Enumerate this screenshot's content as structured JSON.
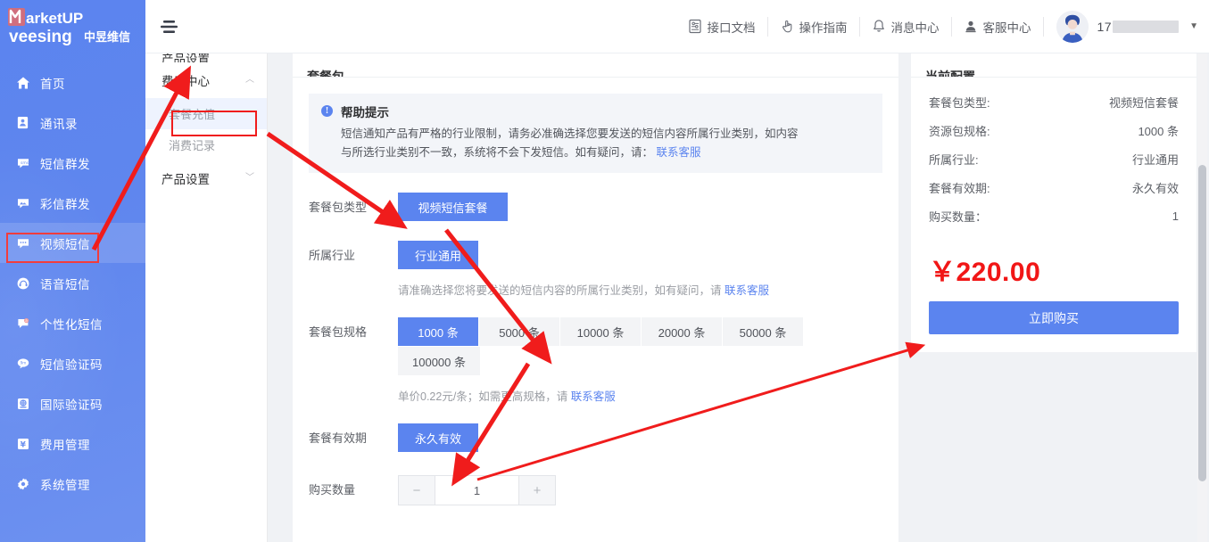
{
  "brand": {
    "line1": "arketUP",
    "line2": "veesing",
    "line2_cn": "中昱维信"
  },
  "sidebar": {
    "items": [
      {
        "label": "首页",
        "icon": "home-icon"
      },
      {
        "label": "通讯录",
        "icon": "contacts-icon"
      },
      {
        "label": "短信群发",
        "icon": "sms-bulk-icon"
      },
      {
        "label": "彩信群发",
        "icon": "mms-bulk-icon"
      },
      {
        "label": "视频短信",
        "icon": "video-sms-icon"
      },
      {
        "label": "语音短信",
        "icon": "voice-sms-icon"
      },
      {
        "label": "个性化短信",
        "icon": "personalized-sms-icon"
      },
      {
        "label": "短信验证码",
        "icon": "sms-code-icon"
      },
      {
        "label": "国际验证码",
        "icon": "intl-code-icon"
      },
      {
        "label": "费用管理",
        "icon": "fee-management-icon"
      },
      {
        "label": "系统管理",
        "icon": "system-settings-icon"
      }
    ],
    "active_index": 4
  },
  "submenu": {
    "cut_label": "产品设置",
    "group_label": "费用中心",
    "group_caret": "︿",
    "items": [
      {
        "label": "套餐充值",
        "current": true
      },
      {
        "label": "消费记录",
        "current": false
      }
    ],
    "group2_label": "产品设置",
    "group2_caret": "﹀"
  },
  "header": {
    "hamburger": "collapse-menu-icon",
    "actions": [
      {
        "label": "接口文档",
        "icon": "api-doc-icon"
      },
      {
        "label": "操作指南",
        "icon": "guide-hand-icon"
      },
      {
        "label": "消息中心",
        "icon": "bell-icon"
      },
      {
        "label": "客服中心",
        "icon": "service-person-icon"
      }
    ],
    "user": {
      "name_prefix": "17",
      "masked": true,
      "caret": "▼"
    }
  },
  "main": {
    "left_card_title": "套餐包",
    "tip": {
      "title": "帮助提示",
      "line1": "短信通知产品有严格的行业限制，请务必准确选择您要发送的短信内容所属行业类别，如内容",
      "line2_pre": "与所选行业类别不一致，系统将不会下发短信。如有疑问，请：",
      "link": "联系客服"
    },
    "fields": [
      {
        "label": "套餐包类型",
        "options": [
          {
            "text": "视频短信套餐",
            "selected": true
          }
        ],
        "hint": ""
      },
      {
        "label": "所属行业",
        "options": [
          {
            "text": "行业通用",
            "selected": true
          }
        ],
        "hint_pre": "请准确选择您将要发送的短信内容的所属行业类别，如有疑问，请 ",
        "hint_link": "联系客服"
      },
      {
        "label": "套餐包规格",
        "options": [
          {
            "text": "1000 条",
            "selected": true
          },
          {
            "text": "5000 条",
            "selected": false
          },
          {
            "text": "10000 条",
            "selected": false
          },
          {
            "text": "20000 条",
            "selected": false
          },
          {
            "text": "50000 条",
            "selected": false
          },
          {
            "text": "100000 条",
            "selected": false
          }
        ],
        "hint_pre": "单价0.22元/条；如需更高规格，请 ",
        "hint_link": "联系客服"
      },
      {
        "label": "套餐有效期",
        "options": [
          {
            "text": "永久有效",
            "selected": true
          }
        ],
        "hint": ""
      }
    ],
    "quantity": {
      "label": "购买数量",
      "minus": "−",
      "value": "1",
      "plus": "+"
    }
  },
  "summary": {
    "title": "当前配置",
    "rows": [
      {
        "key": "套餐包类型:",
        "value": "视频短信套餐"
      },
      {
        "key": "资源包规格:",
        "value": "1000 条"
      },
      {
        "key": "所属行业:",
        "value": "行业通用"
      },
      {
        "key": "套餐有效期:",
        "value": "永久有效"
      },
      {
        "key": "购买数量：",
        "value": "1"
      }
    ],
    "price": "￥220.00",
    "buy_label": "立即购买"
  },
  "colors": {
    "brand_blue": "#5b84ef",
    "price_red": "#f11616",
    "annotation_red": "#f01c1c",
    "page_bg": "#f0f2f5"
  }
}
